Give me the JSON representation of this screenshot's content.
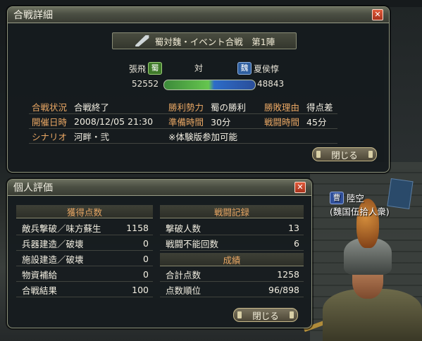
{
  "battle_window": {
    "title": "合戦詳細",
    "header": "蜀対魏・イベント合戦　第1陣",
    "left_commander": "張飛",
    "left_faction": "蜀",
    "vs_label": "対",
    "right_faction": "魏",
    "right_commander": "夏侯惇",
    "left_score": "52552",
    "right_score": "48843",
    "left_share_fraction": 0.52,
    "rows": [
      {
        "k1": "合戦状況",
        "v1": "合戦終了",
        "k2": "勝利勢力",
        "v2": "蜀の勝利",
        "k3": "勝敗理由",
        "v3": "得点差"
      },
      {
        "k1": "開催日時",
        "v1": "2008/12/05 21:30",
        "k2": "準備時間",
        "v2": "30分",
        "k3": "戦闘時間",
        "v3": "45分"
      },
      {
        "k1": "シナリオ",
        "v1": "河畔・弐",
        "k2": "",
        "v2": "※体験版参加可能",
        "k3": "",
        "v3": ""
      }
    ],
    "close_label": "閉じる"
  },
  "eval_window": {
    "title": "個人評価",
    "points_header": "獲得点数",
    "points": [
      {
        "label": "敵兵撃破／味方蘇生",
        "value": "1158"
      },
      {
        "label": "兵器建造／破壊",
        "value": "0"
      },
      {
        "label": "施設建造／破壊",
        "value": "0"
      },
      {
        "label": "物資補給",
        "value": "0"
      },
      {
        "label": "合戦結果",
        "value": "100"
      }
    ],
    "record_header": "戦闘記録",
    "records": [
      {
        "label": "撃破人数",
        "value": "13"
      },
      {
        "label": "戦闘不能回数",
        "value": "6"
      }
    ],
    "results_header": "成績",
    "results": [
      {
        "label": "合計点数",
        "value": "1258"
      },
      {
        "label": "点数順位",
        "value": "96/898"
      }
    ],
    "close_label": "閉じる"
  },
  "character": {
    "badge": "曹",
    "name": "陸空",
    "affiliation": "(魏国伍拾人衆)"
  },
  "icons": {
    "close": "close-icon",
    "sword": "crossed-swords-icon"
  },
  "colors": {
    "label_orange": "#e9a764",
    "shu_green": "#66c64f",
    "wei_blue": "#2d6cc8"
  }
}
